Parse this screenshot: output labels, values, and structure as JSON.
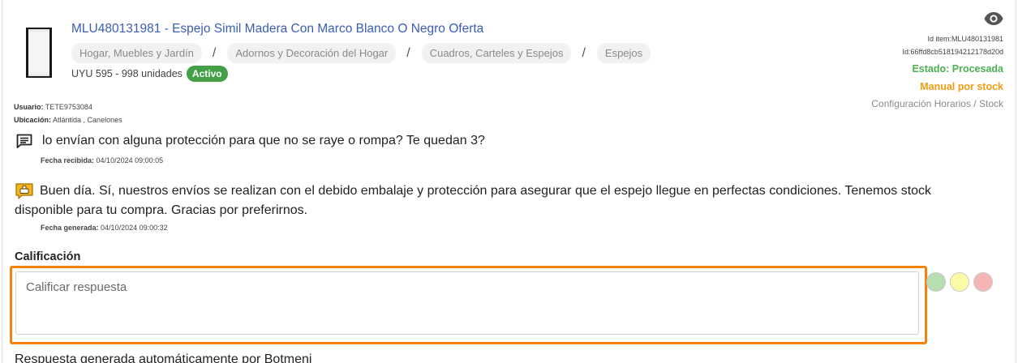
{
  "item": {
    "title": "MLU480131981 - Espejo Simil Madera Con Marco Blanco O Negro Oferta",
    "breadcrumb": [
      "Hogar, Muebles y Jardín",
      "Adornos y Decoración del Hogar",
      "Cuadros, Carteles y Espejos",
      "Espejos"
    ],
    "breadcrumb_separator": "/",
    "price_units": "UYU 595 - 998 unidades",
    "status_badge": "Activo"
  },
  "user": {
    "usuario_label": "Usuario:",
    "usuario_value": "TETE9753084",
    "ubicacion_label": "Ubicación:",
    "ubicacion_value": "Atlántida , Canelones"
  },
  "meta": {
    "id_item": "Id item:MLU480131981",
    "id": "Id:66ffd8cb518194212178d20d",
    "estado": "Estado: Procesada",
    "manual": "Manual por stock",
    "config": "Configuración Horarios / Stock"
  },
  "question": {
    "text": "lo envían con alguna protección para que no se raye o rompa? Te quedan 3?",
    "date_label": "Fecha recibida:",
    "date_value": "04/10/2024 09:00:05"
  },
  "answer": {
    "text": "Buen día. Sí, nuestros envíos se realizan con el debido embalaje y protección para asegurar que el espejo llegue en perfectas condiciones. Tenemos stock disponible para tu compra. Gracias por preferirnos.",
    "date_label": "Fecha generada:",
    "date_value": "04/10/2024 09:00:32"
  },
  "rating": {
    "label": "Calificación",
    "placeholder": "Calificar respuesta",
    "colors": {
      "good": "#b6deb1",
      "neutral": "#fbfba7",
      "bad": "#f6b5b5"
    },
    "highlight_color": "#f5820b"
  },
  "footer": {
    "text": "Respuesta generada automáticamente por Botmeni"
  },
  "icons": [
    "product-thumbnail",
    "eye-icon",
    "question-chat-icon",
    "answer-thumb-icon"
  ]
}
